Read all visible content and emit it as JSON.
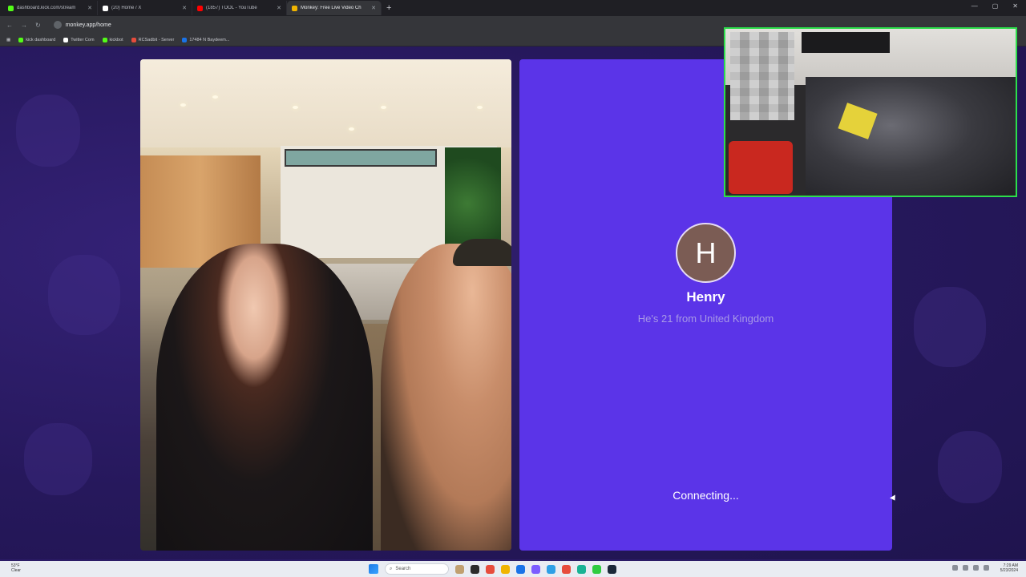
{
  "browser": {
    "tabs": [
      {
        "title": "dashboard.kick.com/stream",
        "favicon_color": "#53fc18"
      },
      {
        "title": "(20) Home / X",
        "favicon_color": "#ffffff"
      },
      {
        "title": "(1857) TOOL - YouTube",
        "favicon_color": "#ff0000"
      },
      {
        "title": "Monkey: Free Live Video Ch",
        "favicon_color": "#f0b400",
        "active": true
      }
    ],
    "new_tab": "+",
    "url": "monkey.app/home",
    "bookmarks": [
      {
        "label": "kick dashboard",
        "color": "#53fc18"
      },
      {
        "label": "Twitter Com",
        "color": "#ffffff"
      },
      {
        "label": "kickbot",
        "color": "#53fc18"
      },
      {
        "label": "RCSadbit - Server",
        "color": "#e64c3c"
      },
      {
        "label": "17484 N Baydeem...",
        "color": "#1a73e8"
      }
    ]
  },
  "match": {
    "avatar_initial": "H",
    "name": "Henry",
    "details": "He's 21 from United Kingdom",
    "status": "Connecting..."
  },
  "taskbar": {
    "weather_temp": "53°F",
    "weather_desc": "Clear",
    "search_placeholder": "Search",
    "time": "7:29 AM",
    "date": "5/23/2024",
    "apps": [
      "#c0a070",
      "#2b2b2b",
      "#e74c3c",
      "#f0b400",
      "#1a73e8",
      "#7b5cff",
      "#2ea0e6",
      "#e74c3c",
      "#19b394",
      "#2ecc40",
      "#1b2838"
    ]
  },
  "colors": {
    "accent": "#5b34e8",
    "webcam_border": "#2dde4b"
  }
}
